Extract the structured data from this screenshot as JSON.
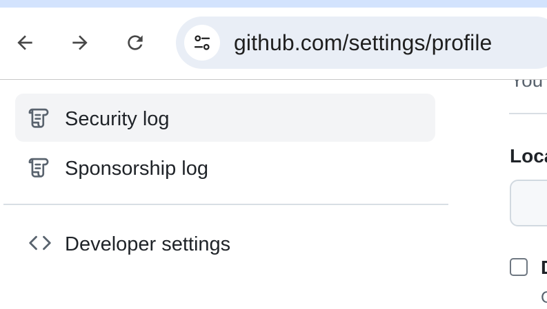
{
  "browser": {
    "url": "github.com/settings/profile",
    "icons": {
      "back": "arrow-left-icon",
      "forward": "arrow-right-icon",
      "reload": "reload-icon",
      "site_info": "tune-icon"
    },
    "colors": {
      "tab_strip": "#d3e3fd",
      "omnibox": "#e9eef6"
    }
  },
  "sidebar": {
    "items": [
      {
        "label": "Security log",
        "icon": "log-icon",
        "active": true
      },
      {
        "label": "Sponsorship log",
        "icon": "log-icon",
        "active": false
      },
      {
        "label": "Developer settings",
        "icon": "code-icon",
        "active": false
      }
    ]
  },
  "main": {
    "cut_off_text": "You c",
    "location_label": "Loca",
    "location_value": "",
    "checkbox_label": "D",
    "checkbox_checked": false,
    "checkbox_description": "C"
  }
}
